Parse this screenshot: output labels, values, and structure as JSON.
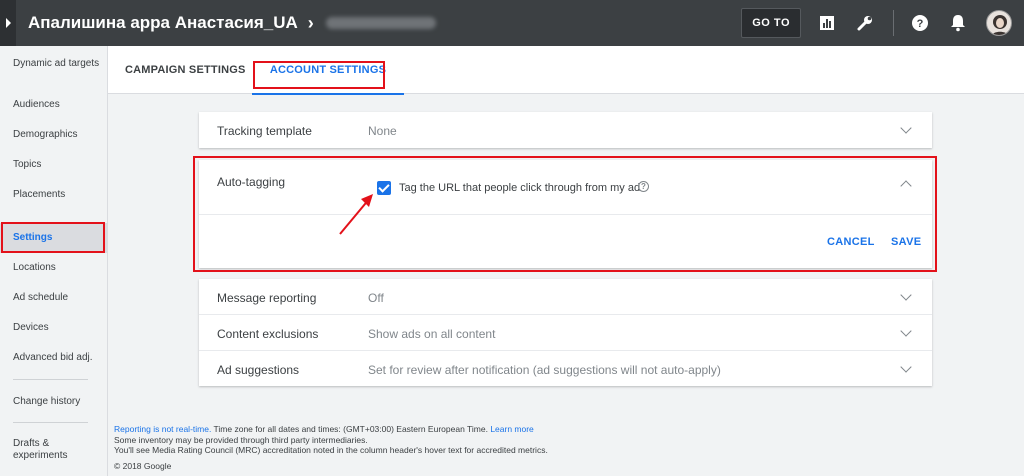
{
  "header": {
    "account_title": "Апалишина аppа Анастасия_UA",
    "breadcrumb_separator": "›",
    "goto_label": "GO TO",
    "icons": [
      "reports-icon",
      "tools-icon",
      "help-icon",
      "notifications-icon",
      "avatar"
    ]
  },
  "sidebar": {
    "items": [
      {
        "label": "Dynamic ad targets"
      },
      {
        "label": "Audiences"
      },
      {
        "label": "Demographics"
      },
      {
        "label": "Topics"
      },
      {
        "label": "Placements"
      },
      {
        "label": "Settings",
        "active": true
      },
      {
        "label": "Locations"
      },
      {
        "label": "Ad schedule"
      },
      {
        "label": "Devices"
      },
      {
        "label": "Advanced bid adj."
      },
      {
        "label": "Change history"
      },
      {
        "label": "Drafts & experiments"
      }
    ]
  },
  "tabs": [
    {
      "label": "CAMPAIGN SETTINGS"
    },
    {
      "label": "ACCOUNT SETTINGS",
      "active": true
    }
  ],
  "settings": {
    "tracking_template": {
      "label": "Tracking template",
      "value": "None"
    },
    "auto_tagging": {
      "label": "Auto-tagging",
      "checkbox_label": "Tag the URL that people click through from my ad",
      "checked": true,
      "cancel_label": "CANCEL",
      "save_label": "SAVE"
    },
    "message_reporting": {
      "label": "Message reporting",
      "value": "Off"
    },
    "content_exclusions": {
      "label": "Content exclusions",
      "value": "Show ads on all content"
    },
    "ad_suggestions": {
      "label": "Ad suggestions",
      "value": "Set for review after notification (ad suggestions will not auto-apply)"
    }
  },
  "footer": {
    "line1_link": "Reporting is not real-time.",
    "line1_text": " Time zone for all dates and times: (GMT+03:00) Eastern European Time. ",
    "line1_learn_more": "Learn more",
    "line2": "Some inventory may be provided through third party intermediaries.",
    "line3": "You'll see Media Rating Council (MRC) accreditation noted in the column header's hover text for accredited metrics.",
    "line4": "© 2018 Google"
  },
  "colors": {
    "accent": "#1a73e8",
    "topbar": "#3c4043",
    "highlight": "#e3111a"
  }
}
